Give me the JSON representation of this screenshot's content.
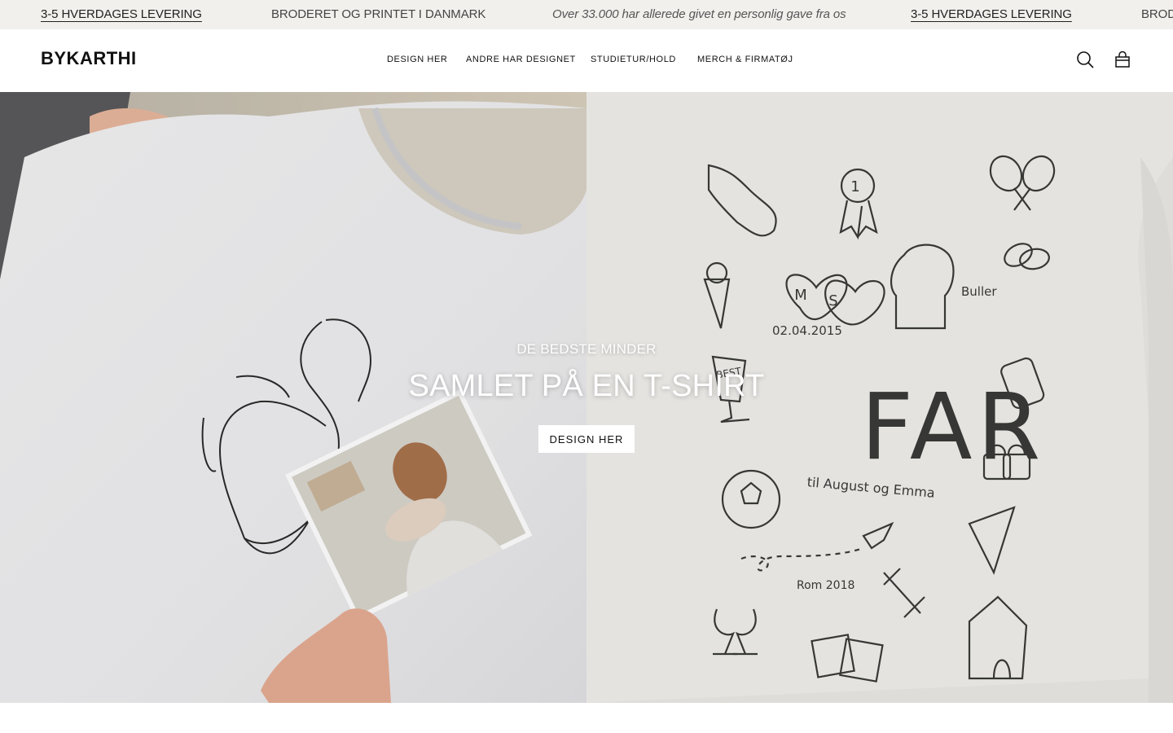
{
  "announcement": {
    "items": [
      "3-5 HVERDAGES LEVERING",
      "BRODERET OG PRINTET I DANMARK",
      "Over 33.000 har allerede givet en personlig gave fra os",
      "3-5 HVERDAGES LEVERING",
      "BROD"
    ]
  },
  "header": {
    "logo": "BYKARTHI",
    "nav": [
      "DESIGN HER",
      "ANDRE HAR DESIGNET",
      "STUDIETUR/HOLD",
      "MERCH & FIRMATØJ"
    ],
    "icons": [
      "search-icon",
      "cart-icon"
    ]
  },
  "hero": {
    "eyebrow": "DE BEDSTE MINDER",
    "title": "SAMLET PÅ EN T-SHIRT",
    "cta": "DESIGN HER",
    "images": {
      "left": "white t-shirt with line drawing and photo",
      "right": "white t-shirt with FAR print"
    },
    "print": {
      "far": "FAR",
      "dedication": "til August og Emma",
      "hearts_left": "M",
      "hearts_right": "S",
      "date": "02.04.2015",
      "dog_name": "Buller",
      "trip": "Rom 2018",
      "medal": "1",
      "cup": "BEST"
    }
  }
}
